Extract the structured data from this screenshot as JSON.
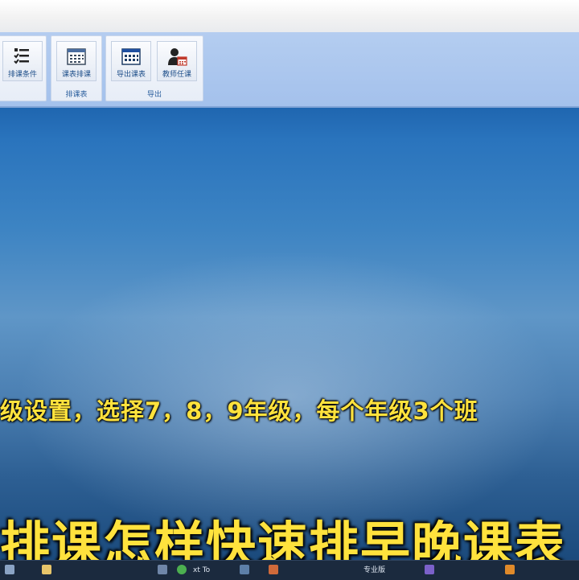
{
  "ribbon": {
    "groups": [
      {
        "label": "",
        "buttons": [
          {
            "label": "排课条件",
            "icon": "list-settings-icon"
          }
        ]
      },
      {
        "label": "排课表",
        "buttons": [
          {
            "label": "课表排课",
            "icon": "calendar-icon"
          }
        ]
      },
      {
        "label": "导出",
        "buttons": [
          {
            "label": "导出课表",
            "icon": "calendar-export-icon"
          },
          {
            "label": "教师任课",
            "icon": "teacher-schedule-icon"
          }
        ]
      }
    ]
  },
  "subtitles": {
    "line1": "级设置，选择7，8，9年级，每个年级3个班",
    "line2": "排课怎样快速排早晚课表"
  },
  "taskbar": {
    "items": [
      "xt To",
      "专业版"
    ]
  },
  "colors": {
    "subtitle": "#ffe23d",
    "ribbon": "#a4c1ec",
    "desktop_top": "#1f66b0",
    "taskbar": "#1b2a3e"
  }
}
